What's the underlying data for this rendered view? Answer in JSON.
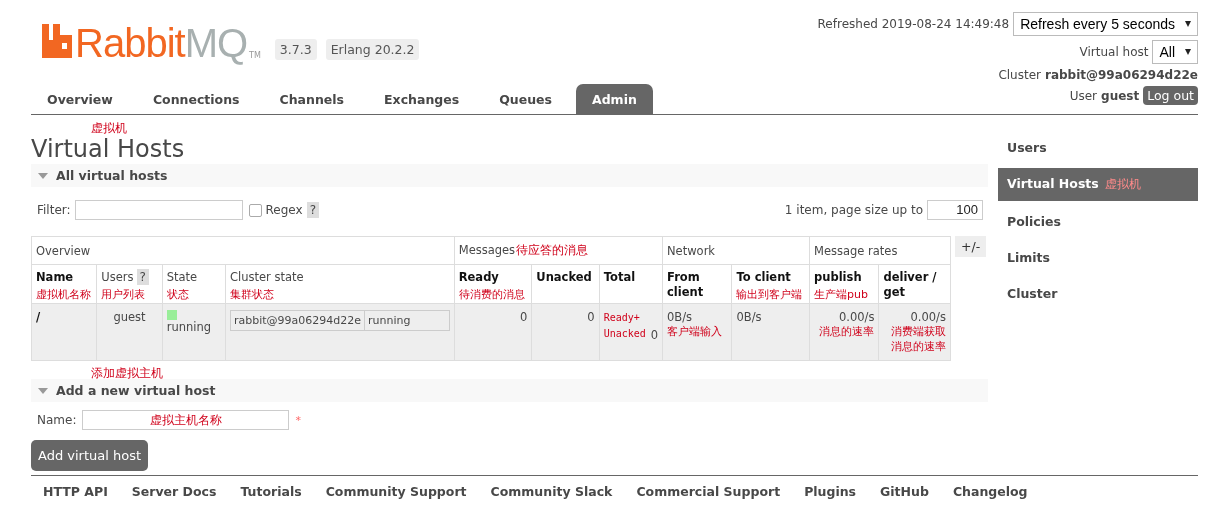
{
  "logo": {
    "word_a": "Rabbit",
    "word_b": "MQ",
    "trademark": "TM"
  },
  "versions": [
    "3.7.3",
    "Erlang 20.2.2"
  ],
  "tabs": [
    {
      "label": "Overview",
      "selected": false
    },
    {
      "label": "Connections",
      "selected": false
    },
    {
      "label": "Channels",
      "selected": false
    },
    {
      "label": "Exchanges",
      "selected": false
    },
    {
      "label": "Queues",
      "selected": false
    },
    {
      "label": "Admin",
      "selected": true
    }
  ],
  "status": {
    "refreshed": "Refreshed 2019-08-24 14:49:48",
    "refresh_select": "Refresh every 5 seconds",
    "vhost_label": "Virtual host",
    "vhost_select": "All",
    "cluster_label": "Cluster",
    "cluster_name": "rabbit@99a06294d22e",
    "user_label": "User",
    "user_name": "guest",
    "logout": "Log out"
  },
  "page": {
    "note": "虚拟机",
    "title": "Virtual Hosts"
  },
  "section_all": {
    "title": "All virtual hosts",
    "expanded": true,
    "filter_label": "Filter:",
    "regex_label": "Regex",
    "regex_checked": false,
    "help": "?",
    "paging": "1 item, page size up to",
    "page_size": "100"
  },
  "table": {
    "toggle": "+/-",
    "groups": [
      {
        "label": "Overview",
        "columns": [
          {
            "label": "Name",
            "sortable": true,
            "note": "虚拟机名称"
          },
          {
            "label": "Users",
            "sortable": false,
            "help": "?",
            "note": "用户列表"
          },
          {
            "label": "State",
            "sortable": false,
            "note": "状态"
          },
          {
            "label": "Cluster state",
            "sortable": false,
            "note": "集群状态"
          }
        ]
      },
      {
        "label": "Messages",
        "note": "待应答的消息",
        "columns": [
          {
            "label": "Ready",
            "sortable": true,
            "note": "待消费的消息"
          },
          {
            "label": "Unacked",
            "sortable": true
          },
          {
            "label": "Total",
            "sortable": true
          }
        ]
      },
      {
        "label": "Network",
        "columns": [
          {
            "label": "From client",
            "sortable": true
          },
          {
            "label": "To client",
            "sortable": true,
            "note": "输出到客户端"
          }
        ]
      },
      {
        "label": "Message rates",
        "columns": [
          {
            "label": "publish",
            "sortable": true,
            "note": "生产端pub"
          },
          {
            "label": "deliver / get",
            "sortable": true
          }
        ]
      }
    ],
    "rows": [
      {
        "cells": [
          {
            "kind": "name",
            "text": "/"
          },
          {
            "kind": "center",
            "text": "guest"
          },
          {
            "kind": "state",
            "color": "#99ee99",
            "text": "running"
          },
          {
            "kind": "cluster",
            "node": "rabbit@99a06294d22e",
            "state": "running"
          },
          {
            "kind": "num",
            "text": "0"
          },
          {
            "kind": "num",
            "text": "0"
          },
          {
            "kind": "num",
            "text": "0",
            "note": "Ready+ Unacked"
          },
          {
            "kind": "left",
            "text": "0B/s",
            "note": "客户端输入"
          },
          {
            "kind": "left",
            "text": "0B/s"
          },
          {
            "kind": "num",
            "text": "0.00/s",
            "note": "消息的速率"
          },
          {
            "kind": "num",
            "text": "0.00/s",
            "note": "消费端获取消息的速率"
          }
        ]
      }
    ]
  },
  "section_add": {
    "note": "添加虚拟主机",
    "title": "Add a new virtual host",
    "expanded": true,
    "name_label": "Name:",
    "name_note": "虚拟主机名称",
    "required": "*",
    "submit": "Add virtual host"
  },
  "sidebar": [
    {
      "label": "Users",
      "selected": false
    },
    {
      "label": "Virtual Hosts",
      "selected": true,
      "note": "虚拟机"
    },
    {
      "label": "Policies",
      "selected": false
    },
    {
      "label": "Limits",
      "selected": false
    },
    {
      "label": "Cluster",
      "selected": false
    }
  ],
  "footer": [
    "HTTP API",
    "Server Docs",
    "Tutorials",
    "Community Support",
    "Community Slack",
    "Commercial Support",
    "Plugins",
    "GitHub",
    "Changelog"
  ]
}
